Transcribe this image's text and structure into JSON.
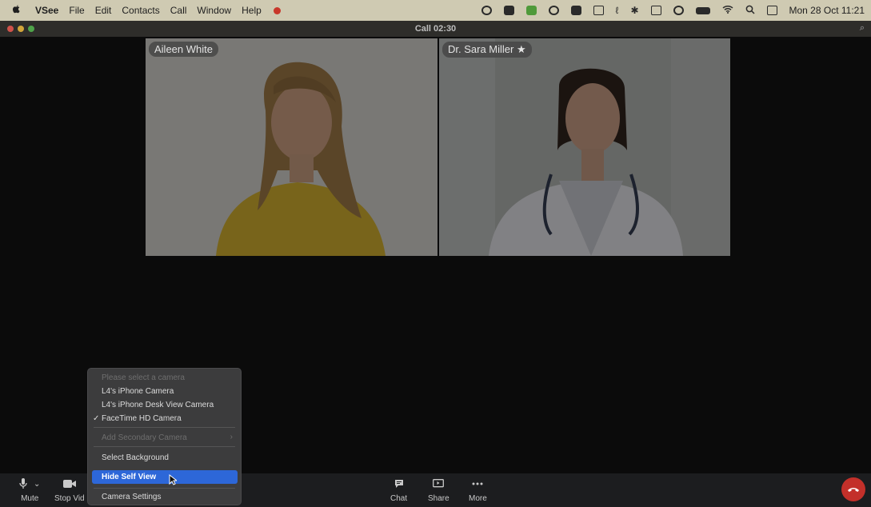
{
  "menubar": {
    "app": "VSee",
    "items": [
      "File",
      "Edit",
      "Contacts",
      "Call",
      "Window",
      "Help"
    ],
    "clock": "Mon 28 Oct  11:21"
  },
  "window": {
    "title": "Call 02:30"
  },
  "participants": [
    {
      "name": "Aileen White"
    },
    {
      "name": "Dr. Sara Miller ★"
    }
  ],
  "toolbar": {
    "mute_label": "Mute",
    "stop_video_label": "Stop Vid",
    "chat_label": "Chat",
    "share_label": "Share",
    "more_label": "More"
  },
  "camera_menu": {
    "header": "Please select a camera",
    "cameras": [
      "L4's iPhone Camera",
      "L4's iPhone Desk View Camera",
      "FaceTime HD Camera"
    ],
    "selected_check": "✓",
    "secondary": "Add Secondary Camera",
    "select_background": "Select Background",
    "hide_self_view": "Hide Self View",
    "camera_settings": "Camera Settings"
  },
  "colors": {
    "menubar_bg": "#cfcab2",
    "highlight": "#2d67d8",
    "hangup": "#c3302a"
  }
}
